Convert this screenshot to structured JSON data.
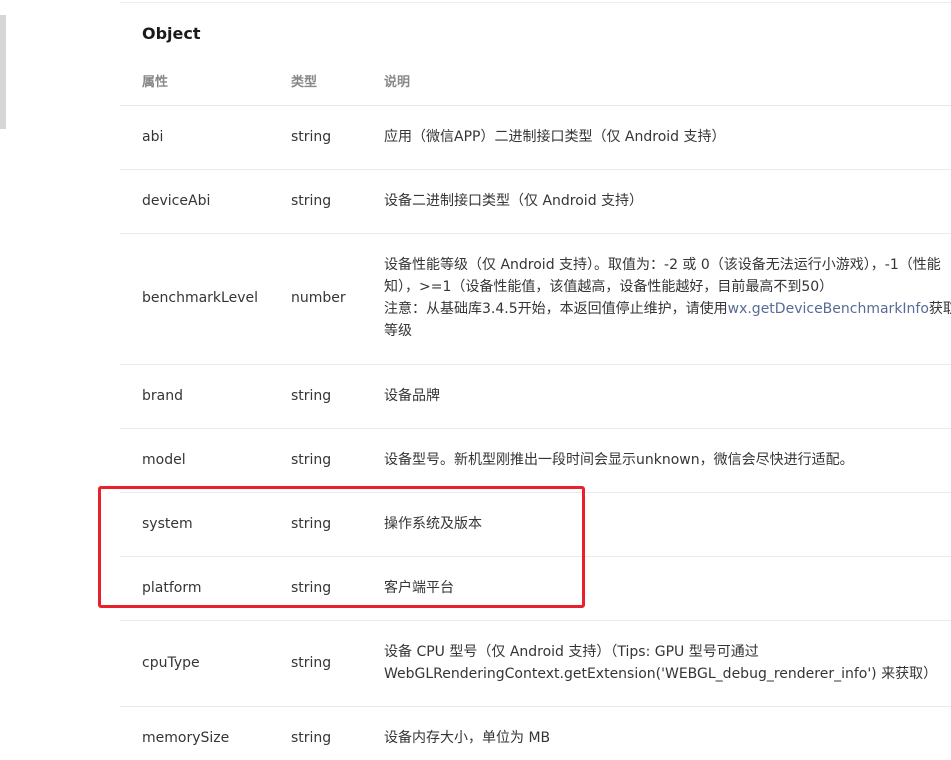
{
  "section": {
    "title": "Object"
  },
  "table": {
    "headers": {
      "property": "属性",
      "type": "类型",
      "description": "说明"
    },
    "rows": [
      {
        "property": "abi",
        "type": "string",
        "description": [
          "应用（微信APP）二进制接口类型（仅 Android 支持）"
        ]
      },
      {
        "property": "deviceAbi",
        "type": "string",
        "description": [
          "设备二进制接口类型（仅 Android 支持）"
        ]
      },
      {
        "property": "benchmarkLevel",
        "type": "number",
        "description_lines": {
          "line1": "设备性能等级（仅 Android 支持）。取值为：-2 或 0（该设备无法运行小游戏），-1（性能",
          "line2": "知），>=1（设备性能值，该值越高，设备性能越好，目前最高不到50）",
          "line3_prefix": "注意：从基础库3.4.5开始，本返回值停止维护，请使用",
          "line3_link": "wx.getDeviceBenchmarkInfo",
          "line3_suffix": "获取设",
          "line4": "等级"
        }
      },
      {
        "property": "brand",
        "type": "string",
        "description": [
          "设备品牌"
        ]
      },
      {
        "property": "model",
        "type": "string",
        "description": [
          "设备型号。新机型刚推出一段时间会显示unknown，微信会尽快进行适配。"
        ]
      },
      {
        "property": "system",
        "type": "string",
        "description": [
          "操作系统及版本"
        ]
      },
      {
        "property": "platform",
        "type": "string",
        "description": [
          "客户端平台"
        ]
      },
      {
        "property": "cpuType",
        "type": "string",
        "description": [
          "设备 CPU 型号（仅 Android 支持）（Tips: GPU 型号可通过",
          "WebGLRenderingContext.getExtension('WEBGL_debug_renderer_info') 来获取）"
        ]
      },
      {
        "property": "memorySize",
        "type": "string",
        "description": [
          "设备内存大小，单位为 MB"
        ]
      }
    ]
  },
  "annotation": {
    "highlight_color": "#e8212b"
  },
  "colors": {
    "link": "#576b95",
    "header_text": "#888888",
    "body_text": "#353535"
  }
}
